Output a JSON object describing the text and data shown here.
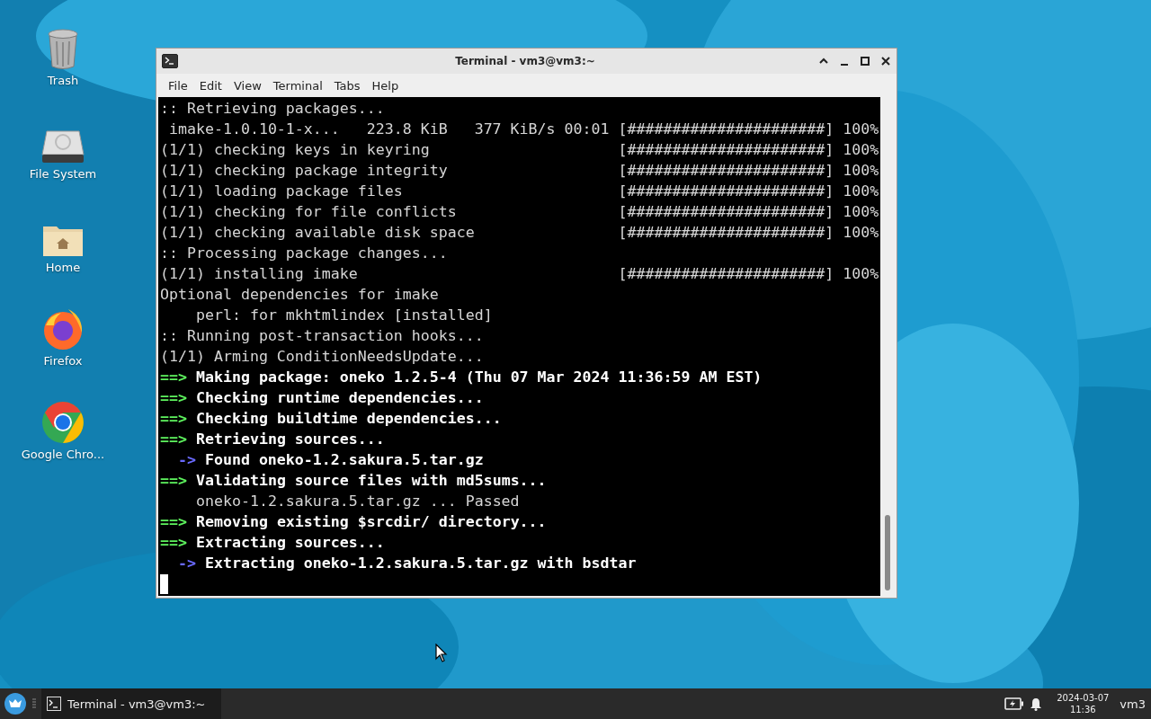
{
  "desktop": {
    "icons": [
      {
        "kind": "trash",
        "label": "Trash"
      },
      {
        "kind": "drive",
        "label": "File System"
      },
      {
        "kind": "home",
        "label": "Home"
      },
      {
        "kind": "firefox",
        "label": "Firefox"
      },
      {
        "kind": "chrome",
        "label": "Google Chro..."
      }
    ]
  },
  "window": {
    "title": "Terminal - vm3@vm3:~",
    "menu": [
      "File",
      "Edit",
      "View",
      "Terminal",
      "Tabs",
      "Help"
    ],
    "lines": [
      {
        "kind": "plain",
        "text": ":: Retrieving packages..."
      },
      {
        "kind": "download",
        "label": "imake-1.0.10-1-x...",
        "size": "223.8 KiB",
        "rate": "377 KiB/s",
        "eta": "00:01",
        "bar": "[######################]",
        "percent": "100%"
      },
      {
        "kind": "progress",
        "label": "(1/1) checking keys in keyring",
        "bar": "[######################]",
        "percent": "100%"
      },
      {
        "kind": "progress",
        "label": "(1/1) checking package integrity",
        "bar": "[######################]",
        "percent": "100%"
      },
      {
        "kind": "progress",
        "label": "(1/1) loading package files",
        "bar": "[######################]",
        "percent": "100%"
      },
      {
        "kind": "progress",
        "label": "(1/1) checking for file conflicts",
        "bar": "[######################]",
        "percent": "100%"
      },
      {
        "kind": "progress",
        "label": "(1/1) checking available disk space",
        "bar": "[######################]",
        "percent": "100%"
      },
      {
        "kind": "plain",
        "text": ":: Processing package changes..."
      },
      {
        "kind": "progress",
        "label": "(1/1) installing imake",
        "bar": "[######################]",
        "percent": "100%"
      },
      {
        "kind": "plain",
        "text": "Optional dependencies for imake"
      },
      {
        "kind": "detail",
        "text": "perl: for mkhtmlindex [installed]"
      },
      {
        "kind": "plain",
        "text": ":: Running post-transaction hooks..."
      },
      {
        "kind": "plain",
        "text": "(1/1) Arming ConditionNeedsUpdate..."
      },
      {
        "kind": "step",
        "marker": "==>",
        "text": "Making package: oneko 1.2.5-4 (Thu 07 Mar 2024 11:36:59 AM EST)"
      },
      {
        "kind": "step",
        "marker": "==>",
        "text": "Checking runtime dependencies..."
      },
      {
        "kind": "step",
        "marker": "==>",
        "text": "Checking buildtime dependencies..."
      },
      {
        "kind": "step",
        "marker": "==>",
        "text": "Retrieving sources..."
      },
      {
        "kind": "sub",
        "marker": "->",
        "text": "Found oneko-1.2.sakura.5.tar.gz"
      },
      {
        "kind": "step",
        "marker": "==>",
        "text": "Validating source files with md5sums..."
      },
      {
        "kind": "detail",
        "text": "oneko-1.2.sakura.5.tar.gz ... Passed"
      },
      {
        "kind": "step",
        "marker": "==>",
        "text": "Removing existing $srcdir/ directory..."
      },
      {
        "kind": "step",
        "marker": "==>",
        "text": "Extracting sources..."
      },
      {
        "kind": "sub",
        "marker": "->",
        "text": "Extracting oneko-1.2.sakura.5.tar.gz with bsdtar"
      },
      {
        "kind": "cursor"
      }
    ]
  },
  "taskbar": {
    "tasks": [
      {
        "label": "Terminal - vm3@vm3:~",
        "selected": true
      }
    ],
    "clock": {
      "date": "2024-03-07",
      "time": "11:36"
    },
    "user": "vm3"
  }
}
